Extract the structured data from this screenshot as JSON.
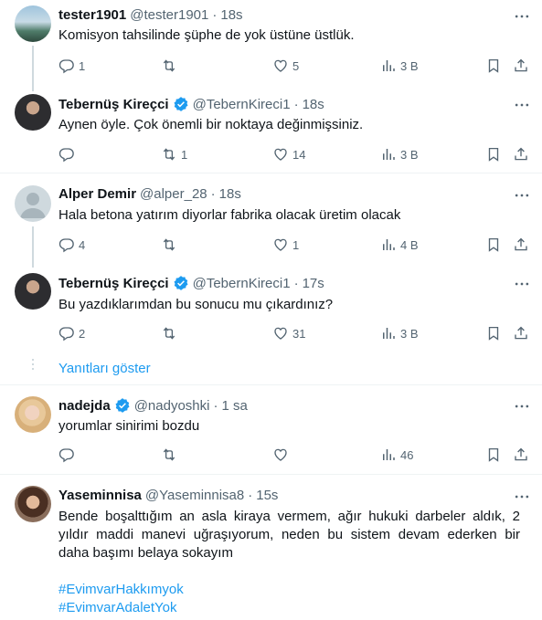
{
  "posts": [
    {
      "name": "tester1901",
      "handle": "@tester1901",
      "sep": "·",
      "time": "18s",
      "text": "Komisyon tahsilinde şüphe de yok üstüne üstlük.",
      "replies": "1",
      "reposts": "",
      "likes": "5",
      "views": "3 B"
    },
    {
      "name": "Tebernüş Kireçci",
      "handle": "@TebernKireci1",
      "sep": "·",
      "time": "18s",
      "text": "Aynen öyle. Çok önemli bir noktaya değinmişsiniz.",
      "replies": "",
      "reposts": "1",
      "likes": "14",
      "views": "3 B"
    },
    {
      "name": "Alper Demir",
      "handle": "@alper_28",
      "sep": "·",
      "time": "18s",
      "text": "Hala betona yatırım diyorlar fabrika olacak üretim olacak",
      "replies": "4",
      "reposts": "",
      "likes": "1",
      "views": "4 B"
    },
    {
      "name": "Tebernüş Kireçci",
      "handle": "@TebernKireci1",
      "sep": "·",
      "time": "17s",
      "text": "Bu yazdıklarımdan bu sonucu mu çıkardınız?",
      "replies": "2",
      "reposts": "",
      "likes": "31",
      "views": "3 B"
    },
    {
      "name": "nadejda",
      "handle": "@nadyoshki",
      "sep": "·",
      "time": "1 sa",
      "text": "yorumlar sinirimi bozdu",
      "replies": "",
      "reposts": "",
      "likes": "",
      "views": "46"
    },
    {
      "name": "Yaseminnisa",
      "handle": "@Yaseminnisa8",
      "sep": "·",
      "time": "15s",
      "text_lines": [
        "Bende boşalttığım an asla kiraya vermem, ağır hukuki darbeler aldık, 2",
        "yıldır maddi manevi uğraşıyorum, neden bu sistem devam ederken bir",
        "daha başımı belaya sokayım"
      ],
      "hashtags": [
        "#EvimvarHakkımyok",
        "#EvimvarAdaletYok"
      ]
    }
  ],
  "show_replies": "Yanıtları göster",
  "colors": {
    "accent": "#1d9bf0",
    "secondary_text": "#536471",
    "verified": "#1d9bf0",
    "thread_line": "#cfd9de"
  },
  "icons": [
    "reply-icon",
    "repost-icon",
    "like-icon",
    "views-icon",
    "bookmark-icon",
    "share-icon",
    "more-icon",
    "verified-badge-icon"
  ]
}
